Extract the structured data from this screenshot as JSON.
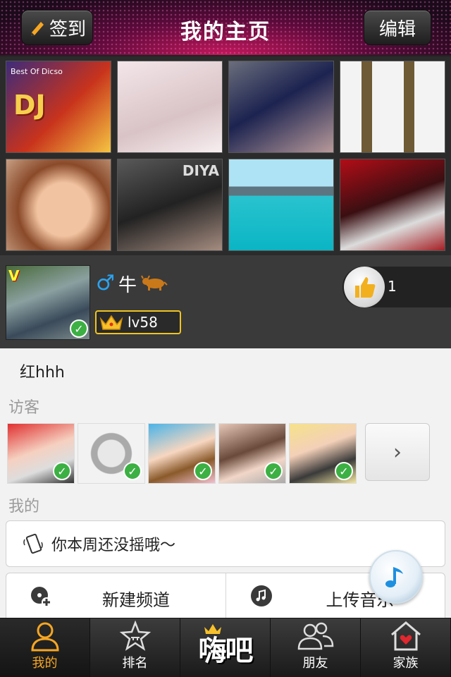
{
  "header": {
    "checkin_label": "签到",
    "title": "我的主页",
    "edit_label": "编辑"
  },
  "photo_grid": {
    "photos": [
      {
        "overlay": "DJ",
        "caption": "Best Of Dicso"
      },
      {
        "overlay": ""
      },
      {
        "overlay": ""
      },
      {
        "overlay": ""
      },
      {
        "overlay": ""
      },
      {
        "overlay": "DIYA"
      },
      {
        "overlay": ""
      },
      {
        "overlay": ""
      }
    ]
  },
  "profile": {
    "gender_symbol": "♂",
    "nickname": "牛",
    "level": "lv58",
    "like_count": "1",
    "avatar_badge": "V"
  },
  "bio": "红hhh",
  "visitors_section": {
    "label": "访客",
    "more_icon": "›"
  },
  "mine_section": {
    "label": "我的",
    "shake_text": "你本周还没摇哦～",
    "new_channel_label": "新建频道",
    "upload_music_label": "上传音乐"
  },
  "tabbar": {
    "tabs": [
      {
        "label": "我的",
        "icon": "person-icon",
        "active": true
      },
      {
        "label": "排名",
        "icon": "star-icon",
        "active": false
      },
      {
        "label": "嗨吧",
        "icon": "haiba-logo",
        "active": false
      },
      {
        "label": "朋友",
        "icon": "friends-icon",
        "active": false
      },
      {
        "label": "家族",
        "icon": "home-heart-icon",
        "active": false
      }
    ]
  },
  "colors": {
    "accent_orange": "#f6a623",
    "header_magenta": "#c2185b",
    "gender_blue": "#2aa3f0",
    "check_green": "#3cb043",
    "level_border": "#f0c420"
  }
}
